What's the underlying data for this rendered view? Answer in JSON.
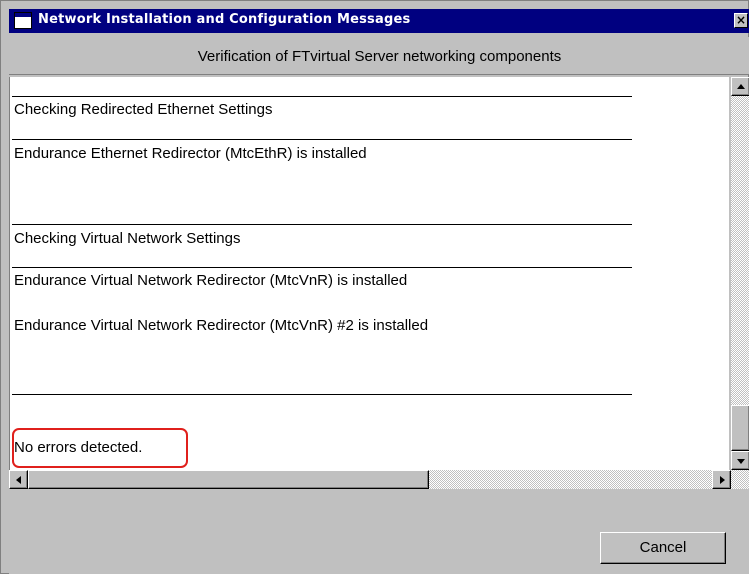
{
  "window": {
    "title": "Network Installation and Configuration Messages",
    "close_label": "×"
  },
  "header": {
    "text": "Verification of FTvirtual Server networking components"
  },
  "messages": [
    "Checking Redirected Ethernet Settings",
    "Endurance Ethernet Redirector (MtcEthR) is installed",
    "Checking Virtual Network Settings",
    "Endurance Virtual Network Redirector (MtcVnR) is installed",
    "Endurance Virtual Network Redirector (MtcVnR) #2 is installed",
    "No errors detected."
  ],
  "footer": {
    "cancel_label": "Cancel"
  },
  "colors": {
    "titlebar": "#000080",
    "highlight": "#e0201c",
    "face": "#c0c0c0"
  }
}
